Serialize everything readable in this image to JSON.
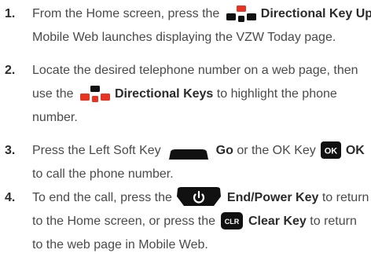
{
  "steps": [
    {
      "number": "1.",
      "lines": {
        "a_pre": "From the Home screen, press the",
        "a_bold": "Directional Key Up",
        "a_post": ".",
        "b": "Mobile Web launches displaying the VZW Today page."
      }
    },
    {
      "number": "2.",
      "lines": {
        "a": "Locate the desired telephone number on a web page, then",
        "b_pre": "use the",
        "b_bold": "Directional Keys",
        "b_post": "to highlight the phone",
        "c": "number."
      }
    },
    {
      "number": "3.",
      "lines": {
        "a_pre": "Press the Left Soft Key",
        "a_bold1": "Go",
        "a_mid": "or the OK Key",
        "a_bold2": "OK",
        "b": "to call the phone number."
      }
    },
    {
      "number": "4.",
      "lines": {
        "a_pre": "To end the call, press the",
        "a_bold": "End/Power Key",
        "a_post": "to return",
        "b_pre": "to the Home screen, or press the",
        "b_bold": "Clear Key",
        "b_post": "to return",
        "c": "to the web page in Mobile Web."
      }
    }
  ],
  "icons": {
    "directional_key": "directional-key-icon",
    "soft_key": "left-soft-key-icon",
    "ok_key": "ok-key-icon",
    "ok_key_text": "OK",
    "end_key": "end-power-key-icon",
    "clr_key": "clear-key-icon",
    "clr_key_text": "CLR"
  },
  "colors": {
    "text": "#4a4a4a",
    "bold_text": "#2b2b2b",
    "key_fill": "#111111",
    "directional_highlight": "#e63322"
  }
}
